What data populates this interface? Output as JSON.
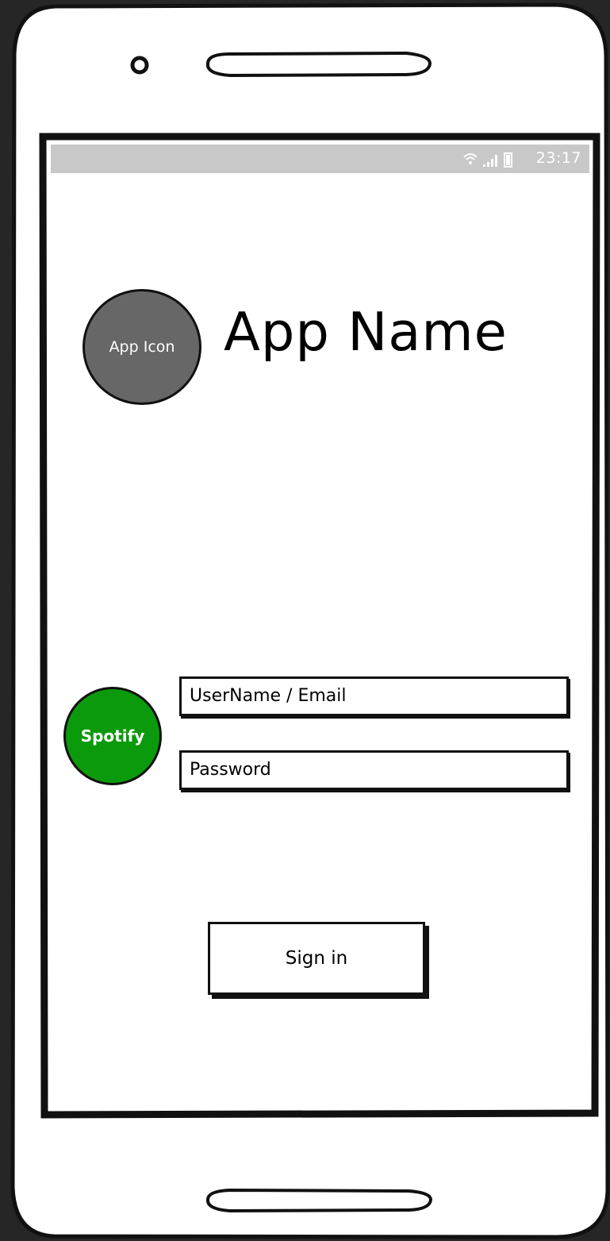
{
  "status_bar": {
    "time": "23:17",
    "icons": [
      "wifi-icon",
      "signal-icon",
      "battery-icon"
    ]
  },
  "header": {
    "app_icon_label": "App Icon",
    "app_name": "App Name"
  },
  "login": {
    "spotify_label": "Spotify",
    "username_placeholder": "UserName / Email",
    "password_placeholder": "Password",
    "sign_in_label": "Sign in"
  },
  "colors": {
    "spotify_green": "#0b9a0b",
    "app_icon_gray": "#676767",
    "status_bar_gray": "#c8c8c8",
    "background": "#262626"
  }
}
